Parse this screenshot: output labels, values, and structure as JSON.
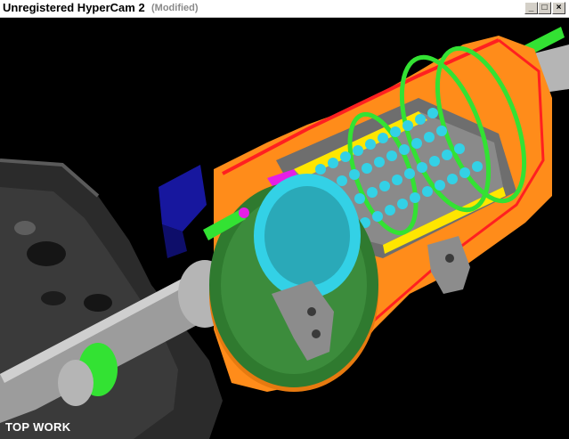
{
  "window": {
    "title": "Unregistered HyperCam 2",
    "status": "(Modified)",
    "minimize_glyph": "_",
    "maximize_glyph": "□",
    "close_glyph": "×"
  },
  "viewport": {
    "subject": "cutaway-3d-model-icon",
    "view_label": "TOP WORK"
  },
  "colors": {
    "housing": "#ff8c1a",
    "section": "#ff2020",
    "rings": "#33e233",
    "balls": "#33d1e6",
    "cage": "#ffe600",
    "seal": "#e61ee6",
    "bracket": "#17179e",
    "steel": "#9c9c9c",
    "frame": "#2b2b2b"
  }
}
